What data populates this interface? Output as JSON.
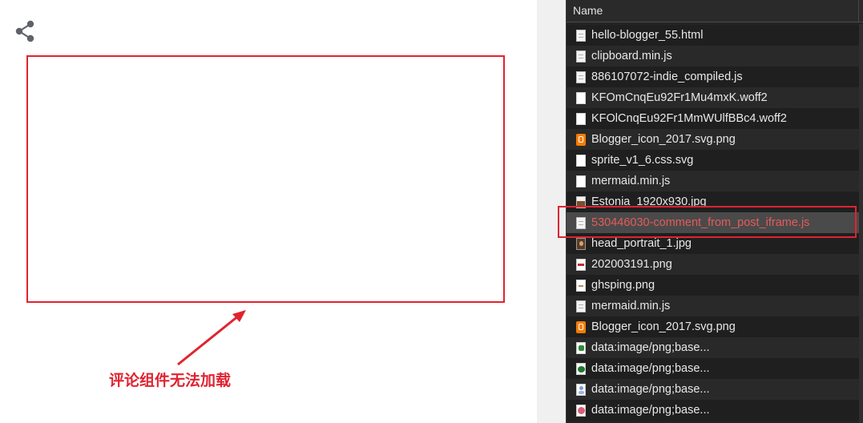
{
  "page": {
    "annotation": "评论组件无法加载"
  },
  "devtools": {
    "column_header": "Name",
    "rows": [
      {
        "name": "hello-blogger_55.html",
        "icon": "document-icon"
      },
      {
        "name": "clipboard.min.js",
        "icon": "document-icon"
      },
      {
        "name": "886107072-indie_compiled.js",
        "icon": "document-icon"
      },
      {
        "name": "KFOmCnqEu92Fr1Mu4mxK.woff2",
        "icon": "file-icon"
      },
      {
        "name": "KFOlCnqEu92Fr1MmWUlfBBc4.woff2",
        "icon": "file-icon"
      },
      {
        "name": "Blogger_icon_2017.svg.png",
        "icon": "blogger-icon"
      },
      {
        "name": "sprite_v1_6.css.svg",
        "icon": "file-icon"
      },
      {
        "name": "mermaid.min.js",
        "icon": "file-icon"
      },
      {
        "name": "Estonia_1920x930.jpg",
        "icon": "image-icon"
      },
      {
        "name": "530446030-comment_from_post_iframe.js",
        "icon": "document-icon",
        "selected": true
      },
      {
        "name": "head_portrait_1.jpg",
        "icon": "portrait-icon"
      },
      {
        "name": "202003191.png",
        "icon": "image-icon"
      },
      {
        "name": "ghsping.png",
        "icon": "image-icon"
      },
      {
        "name": "mermaid.min.js",
        "icon": "document-icon"
      },
      {
        "name": "Blogger_icon_2017.svg.png",
        "icon": "blogger-icon"
      },
      {
        "name": "data:image/png;base...",
        "icon": "image-icon"
      },
      {
        "name": "data:image/png;base...",
        "icon": "image-icon"
      },
      {
        "name": "data:image/png;base...",
        "icon": "image-icon"
      },
      {
        "name": "data:image/png;base...",
        "icon": "image-icon"
      }
    ]
  },
  "colors": {
    "annotation_red": "#e02331",
    "selected_row_text": "#e55b5b",
    "devtools_bg": "#242424"
  }
}
